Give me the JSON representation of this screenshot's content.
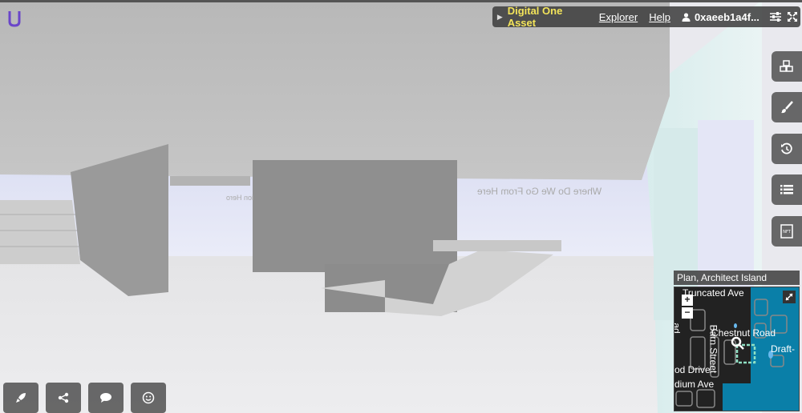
{
  "topbar": {
    "asset_name": "Digital One Asset",
    "explorer_label": "Explorer",
    "help_label": "Help",
    "user_address": "0xaeeb1a4f..."
  },
  "minimap": {
    "title": "Plan, Architect Island",
    "zoom_in": "+",
    "zoom_out": "−",
    "streets": {
      "truncated_ave": "Truncated Ave",
      "chestnut_road": "Chestnut Road",
      "barn_street": "Barn Street",
      "draft": "Draft-",
      "od_drive": "od Drive",
      "dium_ave": "dium Ave",
      "ad": "ad"
    }
  },
  "scene": {
    "wall_text_1": "Where Do We Go From Here",
    "wall_text_2": "ion Hero"
  },
  "colors": {
    "asset_yellow": "#f3e45a",
    "map_water": "#0a7fa8",
    "map_highlight": "#8fe0c4",
    "toolbar_bg": "#505050"
  },
  "icons": {
    "rightbar": [
      "blocks-icon",
      "brush-icon",
      "history-icon",
      "list-icon",
      "nft-icon"
    ],
    "bottombar": [
      "rocket-icon",
      "share-icon",
      "chat-icon",
      "emoji-icon"
    ]
  }
}
